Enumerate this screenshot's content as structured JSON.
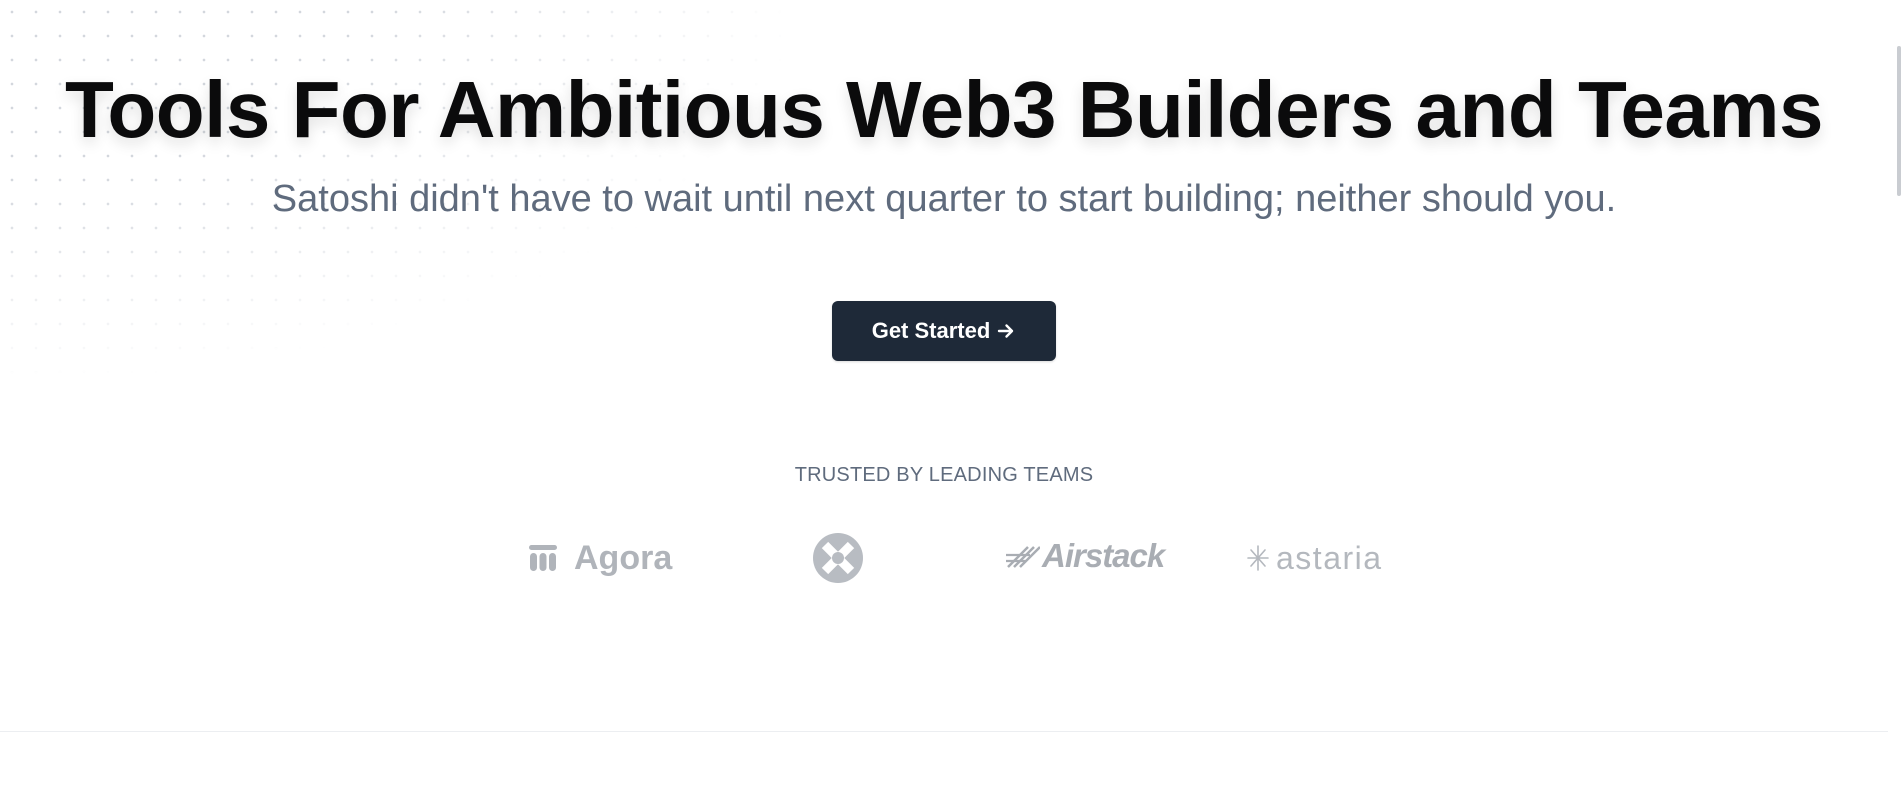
{
  "hero": {
    "title": "Tools For Ambitious Web3 Builders and Teams",
    "subtitle": "Satoshi didn't have to wait until next quarter to start building; neither should you.",
    "cta_label": "Get Started",
    "cta_icon": "arrow-right-icon"
  },
  "trusted": {
    "label": "TRUSTED BY LEADING TEAMS",
    "logos": [
      {
        "name": "Agora",
        "icon": "agora-logo-icon"
      },
      {
        "name": "",
        "icon": "zerox-logo-icon"
      },
      {
        "name": "Airstack",
        "icon": "airstack-logo-icon"
      },
      {
        "name": "astaria",
        "icon": "astaria-logo-icon"
      }
    ]
  },
  "colors": {
    "title": "#0b0b0c",
    "subtitle": "#5f6b7d",
    "button_bg": "#1e2938",
    "button_text": "#ffffff",
    "logo_gray": "#b4b8be"
  }
}
